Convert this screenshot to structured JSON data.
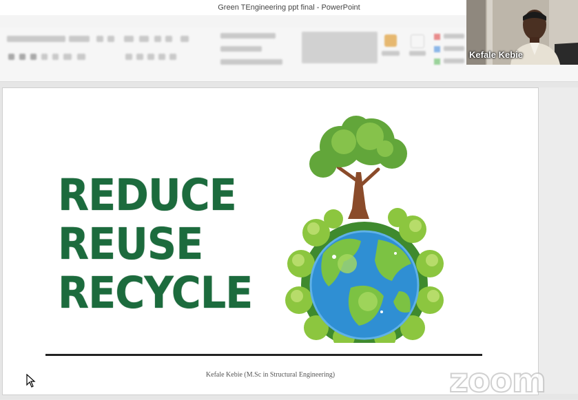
{
  "window": {
    "title": "Green TEngineering ppt final - PowerPoint"
  },
  "ribbon": {
    "tabs": [
      "",
      "",
      "",
      "",
      "",
      "",
      "",
      ""
    ],
    "groups": [
      "",
      "",
      "",
      ""
    ]
  },
  "video": {
    "speaker_name": "Kefale Kebie"
  },
  "slide": {
    "slogan": [
      "REDUCE",
      "REUSE",
      "RECYCLE"
    ],
    "author": "Kefale Kebie (M.Sc in Structural Engineering)"
  },
  "overlay": {
    "logo_text": "zoom"
  },
  "colors": {
    "slogan_green": "#1c6b3d",
    "leaf_green": "#7cc243",
    "earth_blue": "#2f8fd3"
  }
}
